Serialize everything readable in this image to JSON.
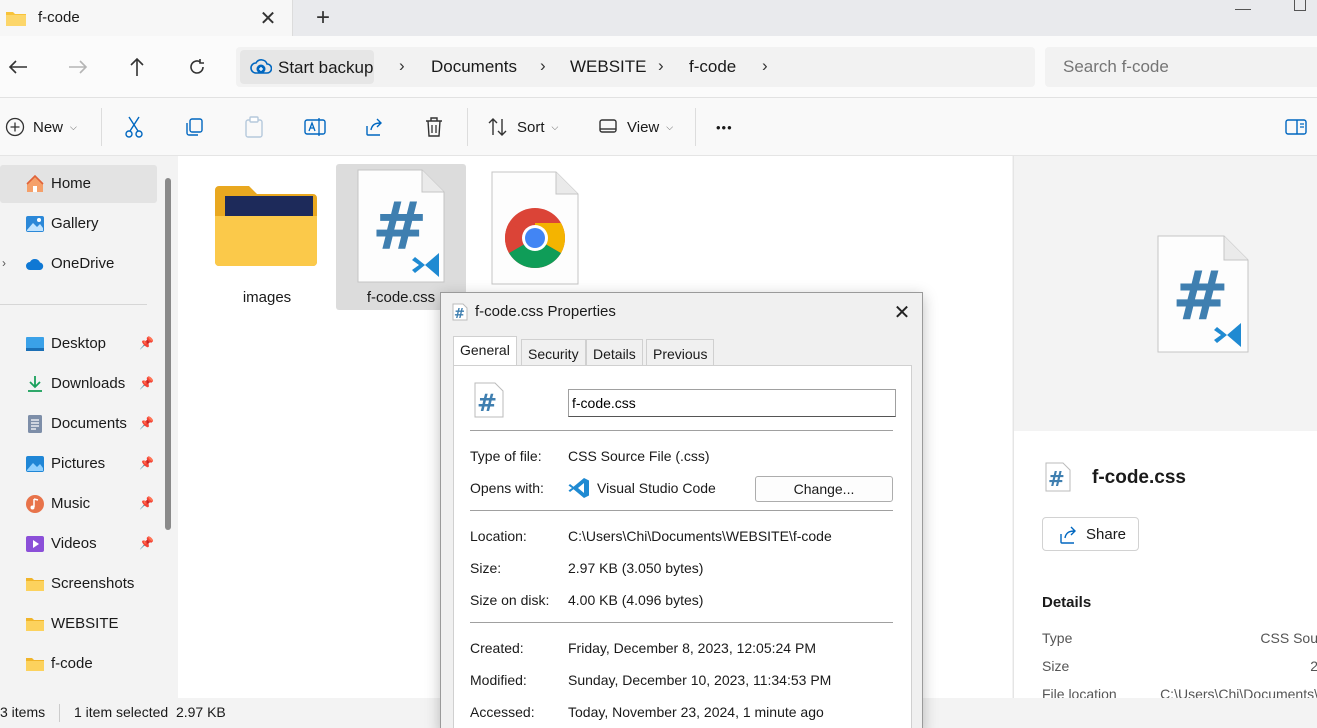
{
  "window": {
    "tab_title": "f-code",
    "close_tab": "✕",
    "new_tab": "+"
  },
  "address": {
    "backup_label": "Start backup",
    "crumbs": [
      "Documents",
      "WEBSITE",
      "f-code"
    ],
    "separator": "›",
    "search_placeholder": "Search f-code"
  },
  "commands": {
    "new_label": "New",
    "sort_label": "Sort",
    "view_label": "View",
    "more_label": "•••"
  },
  "sidebar": {
    "items": [
      {
        "label": "Home",
        "icon": "home-icon"
      },
      {
        "label": "Gallery",
        "icon": "gallery-icon"
      },
      {
        "label": "OneDrive",
        "icon": "cloud-icon"
      },
      {
        "label": "Desktop",
        "icon": "desktop-icon"
      },
      {
        "label": "Downloads",
        "icon": "download-icon"
      },
      {
        "label": "Documents",
        "icon": "document-icon"
      },
      {
        "label": "Pictures",
        "icon": "pictures-icon"
      },
      {
        "label": "Music",
        "icon": "music-icon"
      },
      {
        "label": "Videos",
        "icon": "videos-icon"
      },
      {
        "label": "Screenshots",
        "icon": "folder-icon"
      },
      {
        "label": "WEBSITE",
        "icon": "folder-icon"
      },
      {
        "label": "f-code",
        "icon": "folder-icon"
      }
    ],
    "pin": "📌",
    "expander": "›"
  },
  "files": [
    {
      "name": "images",
      "icon": "folder-with-image-icon"
    },
    {
      "name": "f-code.css",
      "icon": "css-file-icon",
      "selected": true
    },
    {
      "name": "",
      "icon": "chrome-html-file-icon"
    }
  ],
  "preview": {
    "file_name": "f-code.css",
    "share_label": "Share",
    "details_heading": "Details",
    "details": [
      {
        "key": "Type",
        "value": "CSS Sou"
      },
      {
        "key": "Size",
        "value": "2"
      },
      {
        "key": "File location",
        "value": "C:\\Users\\Chi\\Documents\\"
      }
    ]
  },
  "status": {
    "items_count": "3 items",
    "selection": "1 item selected  2.97 KB"
  },
  "dialog": {
    "title": "f-code.css Properties",
    "close": "✕",
    "tabs": [
      "General",
      "Security",
      "Details",
      "Previous Versions"
    ],
    "active_tab": "General",
    "file_name_value": "f-code.css",
    "type_label": "Type of file:",
    "type_value": "CSS Source File (.css)",
    "opens_label": "Opens with:",
    "opens_value": "Visual Studio Code",
    "change_label": "Change...",
    "location_label": "Location:",
    "location_value": "C:\\Users\\Chi\\Documents\\WEBSITE\\f-code",
    "size_label": "Size:",
    "size_value": "2.97 KB (3.050 bytes)",
    "size_disk_label": "Size on disk:",
    "size_disk_value": "4.00 KB (4.096 bytes)",
    "created_label": "Created:",
    "created_value": "Friday, December 8, 2023, 12:05:24 PM",
    "modified_label": "Modified:",
    "modified_value": "Sunday, December 10, 2023, 11:34:53 PM",
    "accessed_label": "Accessed:",
    "accessed_value": "Today, November 23, 2024, 1 minute ago"
  },
  "colors": {
    "accent": "#0067c0",
    "folder_yellow": "#f8c33a",
    "css_hash": "#3f7fb0",
    "vscode_blue": "#1f8ad2"
  }
}
